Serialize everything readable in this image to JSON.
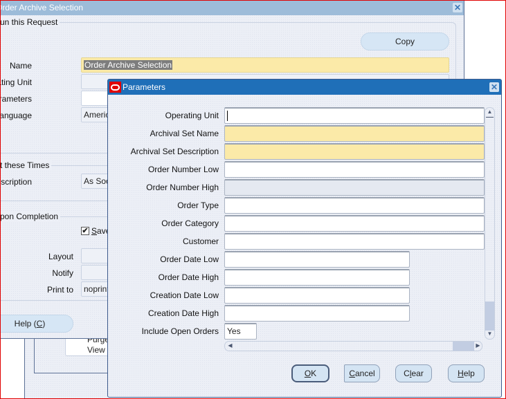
{
  "background_window": {
    "title": "Order Archive Selection",
    "close_icon": "close-x-icon",
    "run_request_group": {
      "title": "Run this Request",
      "copy_button": "Copy",
      "fields": [
        {
          "label": "Name",
          "value": "Order Archive Selection",
          "style": "yellow-selected"
        },
        {
          "label": "Operating Unit",
          "value": ""
        },
        {
          "label": "Parameters",
          "value": ""
        },
        {
          "label": "Language",
          "value": "American English"
        }
      ]
    },
    "schedule_group": {
      "title": "At these Times",
      "schedule_label": "Schedule Description",
      "schedule_value": "As Soon as Possible"
    },
    "completion_group": {
      "title": "Upon Completion",
      "save_checkbox_label": "Save all Output Files",
      "save_checked": true,
      "fields": [
        {
          "label": "Layout",
          "value": ""
        },
        {
          "label": "Notify",
          "value": ""
        },
        {
          "label": "Print to",
          "value": "noprint"
        }
      ]
    },
    "help_button": "Help (C)",
    "underlying_items": [
      "Purge",
      "View"
    ]
  },
  "parameters_dialog": {
    "title": "Parameters",
    "logo": "oracle-logo-icon",
    "close_icon": "close-x-icon",
    "fields": [
      {
        "label": "Operating Unit",
        "value": "",
        "style": "white",
        "width": "full",
        "focused": true
      },
      {
        "label": "Archival Set Name",
        "value": "",
        "style": "yellow",
        "width": "full"
      },
      {
        "label": "Archival Set Description",
        "value": "",
        "style": "yellow",
        "width": "full"
      },
      {
        "label": "Order Number Low",
        "value": "",
        "style": "white",
        "width": "full"
      },
      {
        "label": "Order Number High",
        "value": "",
        "style": "gray",
        "width": "full"
      },
      {
        "label": "Order Type",
        "value": "",
        "style": "white",
        "width": "full"
      },
      {
        "label": "Order Category",
        "value": "",
        "style": "white",
        "width": "full"
      },
      {
        "label": "Customer",
        "value": "",
        "style": "white",
        "width": "full"
      },
      {
        "label": "Order Date Low",
        "value": "",
        "style": "white",
        "width": "half"
      },
      {
        "label": "Order Date High",
        "value": "",
        "style": "white",
        "width": "half"
      },
      {
        "label": "Creation Date Low",
        "value": "",
        "style": "white",
        "width": "half"
      },
      {
        "label": "Creation Date High",
        "value": "",
        "style": "white",
        "width": "half"
      },
      {
        "label": "Include Open Orders",
        "value": "Yes",
        "style": "white",
        "width": "small"
      }
    ],
    "vertical_scroll_position": 0.95,
    "horizontal_scroll_position": 0.95,
    "buttons": {
      "ok": "OK",
      "cancel": "Cancel",
      "clear": "Clear",
      "help": "Help"
    }
  }
}
